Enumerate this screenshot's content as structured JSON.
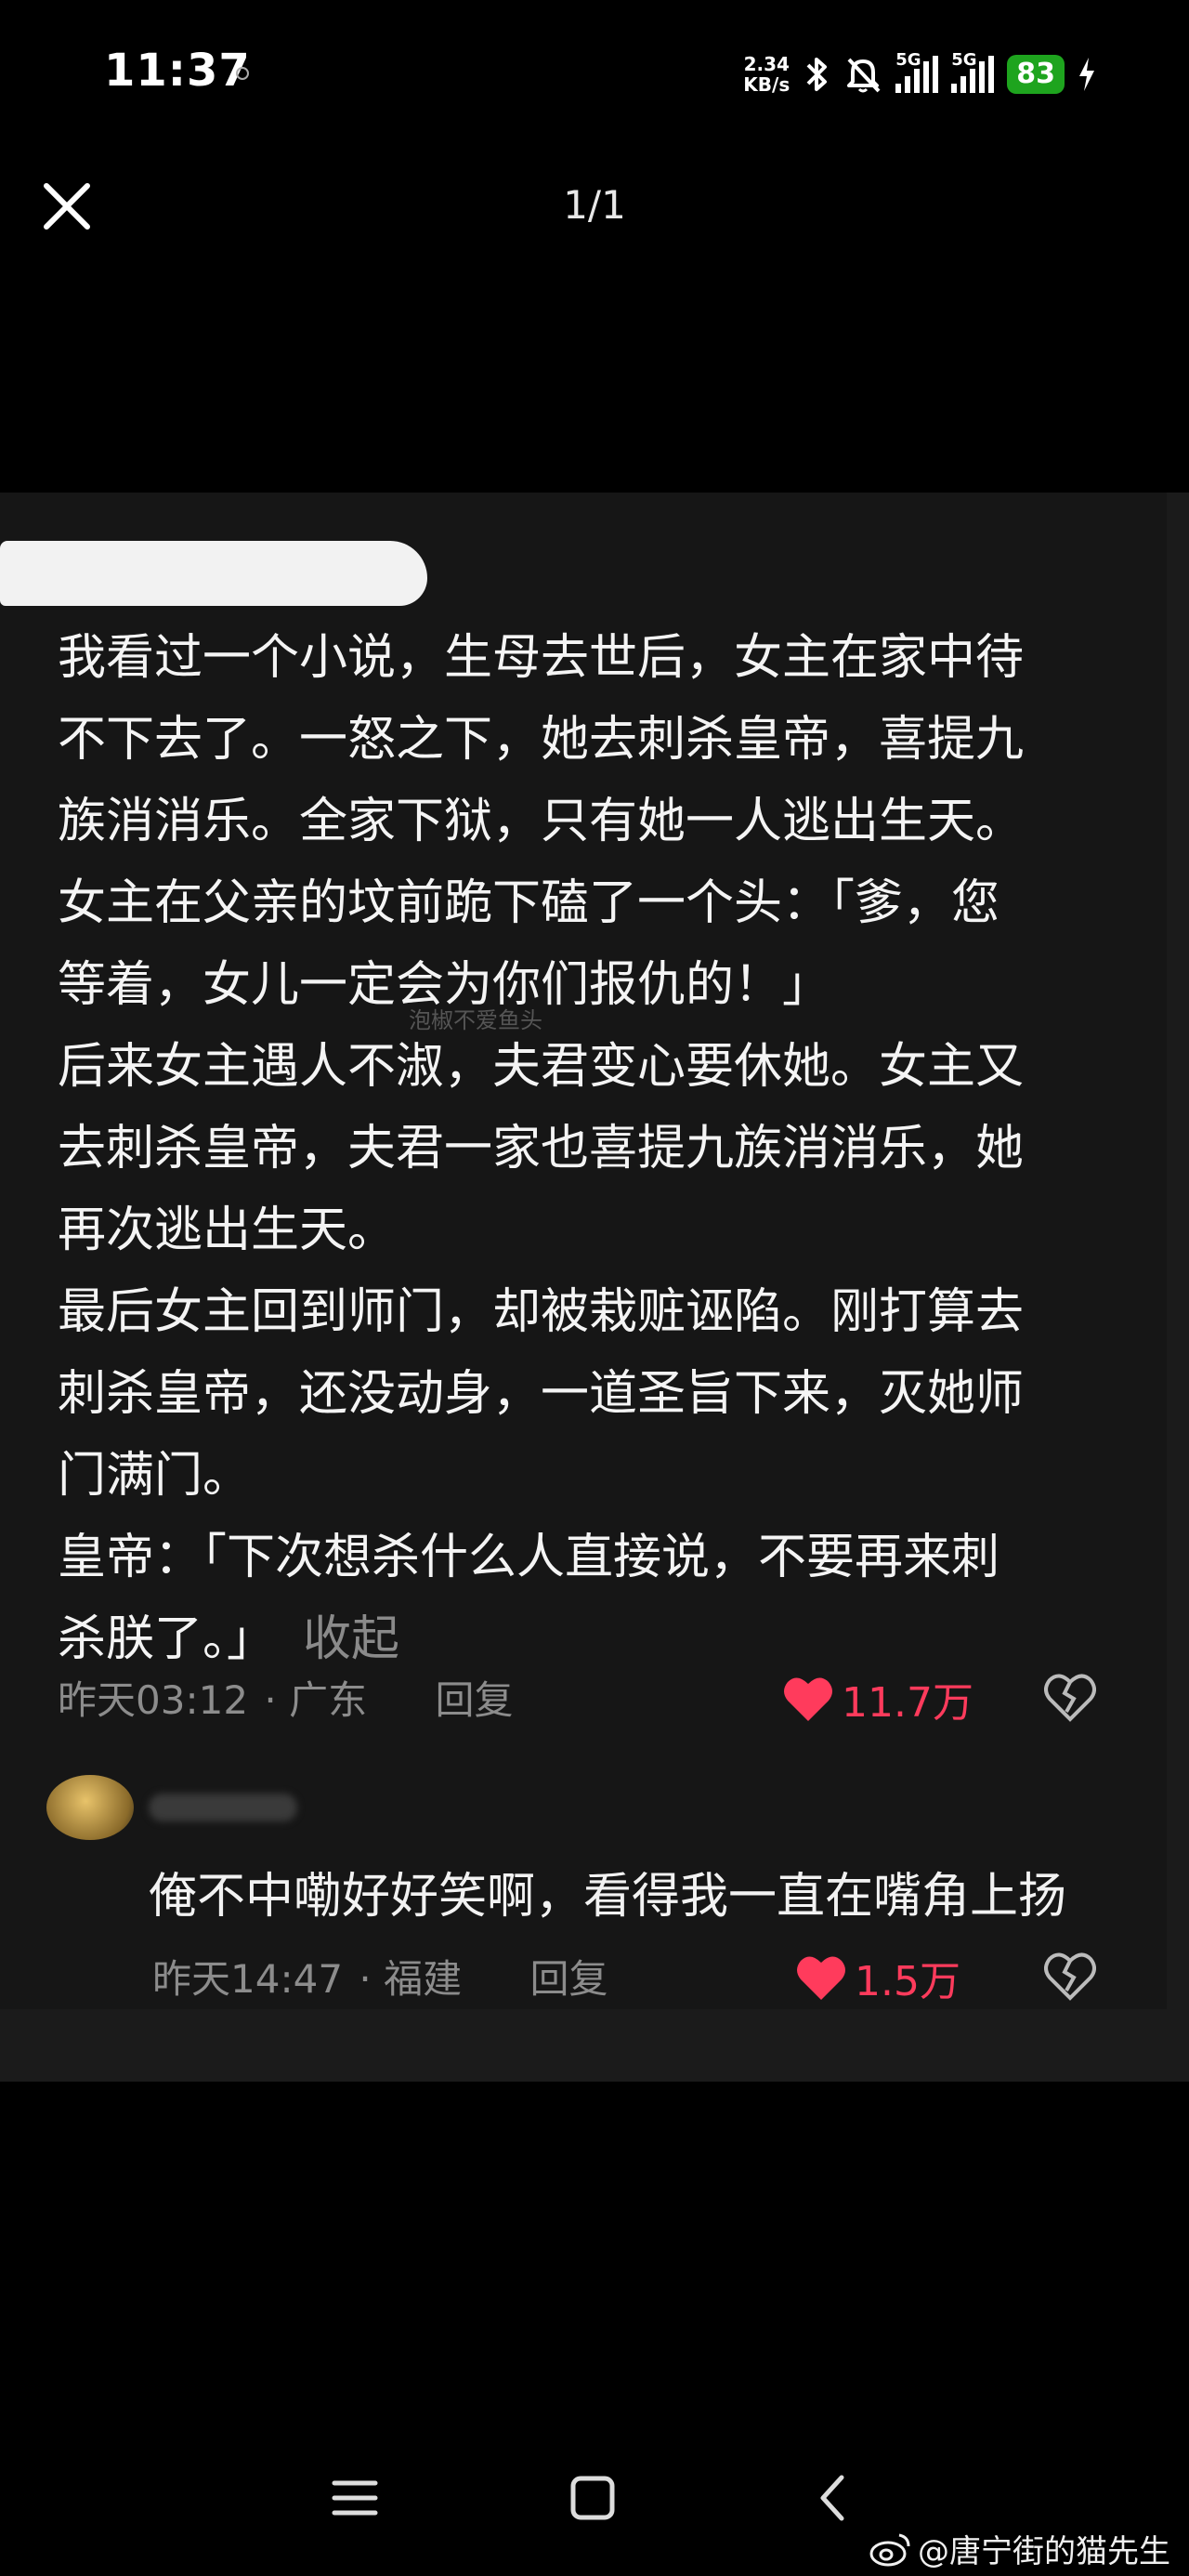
{
  "status_bar": {
    "time": "11:37",
    "net_speed_value": "2.34",
    "net_speed_unit": "KB/s",
    "signal1_label": "5G",
    "signal2_label": "5G",
    "battery": "83",
    "battery_color": "#1ea41e"
  },
  "viewer": {
    "page_counter": "1/1",
    "close_icon": "close-icon"
  },
  "comment": {
    "lines": [
      "我看过一个小说，生母去世后，女主在家中待",
      "不下去了。一怒之下，她去刺杀皇帝，喜提九",
      "族消消乐。全家下狱，只有她一人逃出生天。",
      "女主在父亲的坟前跪下磕了一个头：「爹，您",
      "等着，女儿一定会为你们报仇的！」",
      "后来女主遇人不淑，夫君变心要休她。女主又",
      "去刺杀皇帝，夫君一家也喜提九族消消乐，她",
      "再次逃出生天。",
      "最后女主回到师门，却被栽赃诬陷。刚打算去",
      "刺杀皇帝，还没动身，一道圣旨下来，灭她师",
      "门满门。",
      "皇帝：「下次想杀什么人直接说，不要再来刺"
    ],
    "last_line": "杀朕了。」",
    "collapse_label": "收起",
    "watermark": "泡椒不爱鱼头",
    "time": "昨天03:12",
    "location": "· 广东",
    "reply_label": "回复",
    "likes": "11.7万",
    "like_color": "#ff3b5c"
  },
  "reply": {
    "text": "俺不中嘞好好笑啊，看得我一直在嘴角上扬",
    "time": "昨天14:47",
    "location": "· 福建",
    "reply_label": "回复",
    "likes": "1.5万"
  },
  "footer": {
    "weibo_handle": "@唐宁街的猫先生"
  }
}
